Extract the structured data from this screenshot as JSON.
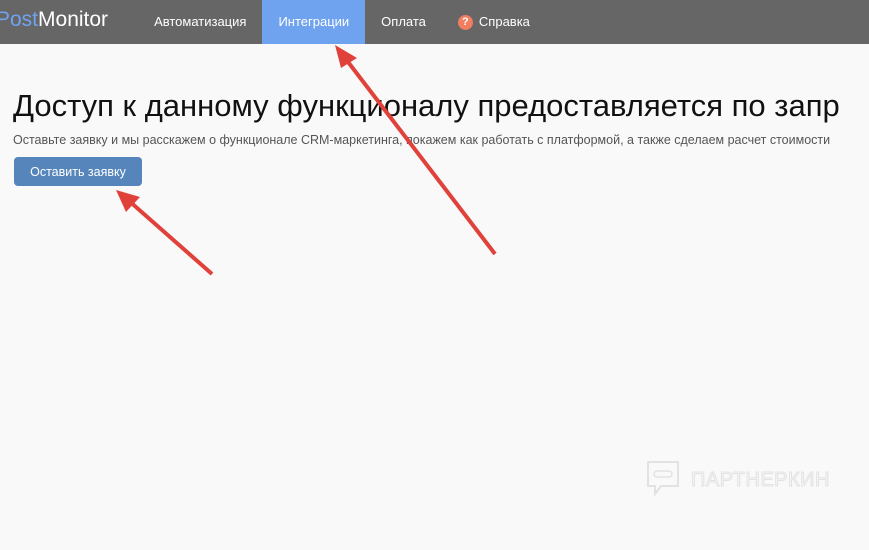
{
  "nav": {
    "logo_part1": "Post",
    "logo_part2": "Monitor",
    "items": [
      {
        "label": "Автоматизация"
      },
      {
        "label": "Интеграции",
        "active": true
      },
      {
        "label": "Оплата"
      },
      {
        "label": "Справка",
        "icon": "question-circle-icon"
      }
    ],
    "help_glyph": "?"
  },
  "main": {
    "title": "Доступ к данному функционалу предоставляется по запр",
    "subtitle": "Оставьте заявку и мы расскажем о функционале CRM-маркетинга, покажем как работать с платформой, а также сделаем расчет стоимости",
    "button_label": "Оставить заявку"
  },
  "watermark": {
    "text": "ПАРТНЕРКИН"
  },
  "colors": {
    "nav_bg": "#666666",
    "accent": "#6fa3ef",
    "button": "#5585bb",
    "arrow": "#e0413a"
  }
}
